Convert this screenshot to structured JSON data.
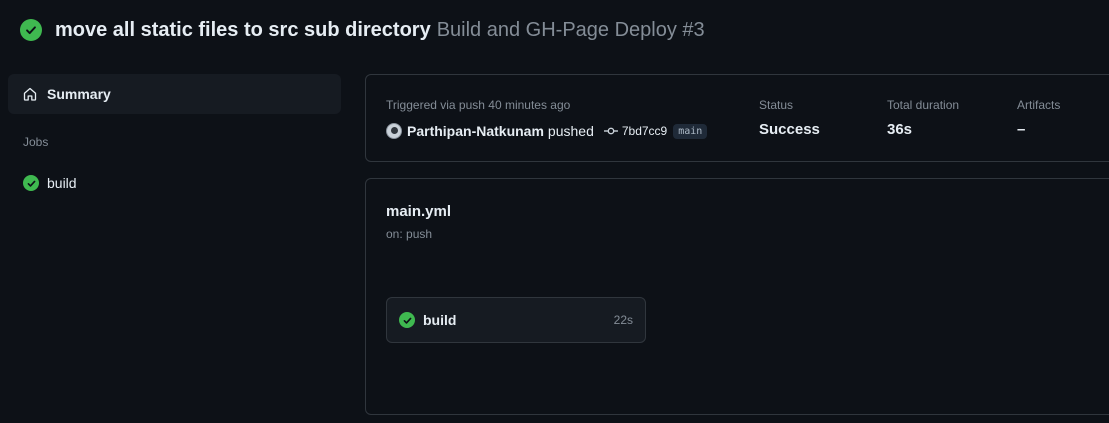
{
  "header": {
    "title": "move all static files to src sub directory",
    "subtitle": "Build and GH-Page Deploy #3",
    "status_icon": "check-circle-icon",
    "status_color": "#3fb950"
  },
  "sidebar": {
    "summary_label": "Summary",
    "summary_icon": "home-icon",
    "jobs_heading": "Jobs",
    "jobs": [
      {
        "label": "build",
        "status": "success"
      }
    ]
  },
  "summary": {
    "trigger_label": "Triggered via push 40 minutes ago",
    "actor": "Parthipan-Natkunam",
    "action": "pushed",
    "commit_sha": "7bd7cc9",
    "branch": "main",
    "status_label": "Status",
    "status_value": "Success",
    "duration_label": "Total duration",
    "duration_value": "36s",
    "artifacts_label": "Artifacts",
    "artifacts_value": "–"
  },
  "workflow": {
    "file": "main.yml",
    "trigger": "on: push",
    "jobs": [
      {
        "name": "build",
        "duration": "22s",
        "status": "success"
      }
    ]
  },
  "colors": {
    "background": "#0d1117",
    "panel": "#161b22",
    "border": "#30363d",
    "success": "#3fb950",
    "muted_text": "#848d97"
  }
}
